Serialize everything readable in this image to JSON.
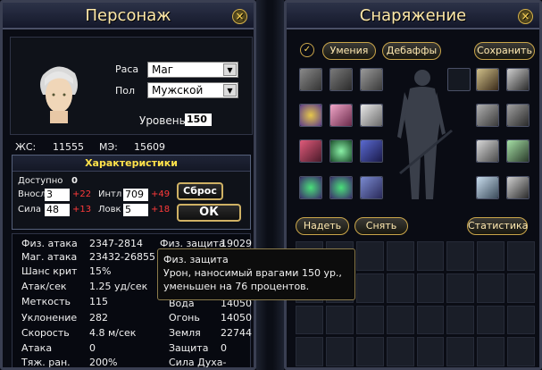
{
  "left": {
    "title": "Персонаж",
    "race_label": "Раса",
    "race_value": "Маг",
    "gender_label": "Пол",
    "gender_value": "Мужской",
    "level_label": "Уровень",
    "level_value": "150",
    "hp_label": "ЖС:",
    "hp_value": "11555",
    "mp_label": "МЭ:",
    "mp_value": "15609",
    "chars_title": "Характеристики",
    "available_label": "Доступно",
    "available_value": "0",
    "vnsl_label": "Вносл",
    "vnsl_value": "3",
    "vnsl_bonus": "+22",
    "intl_label": "Интл",
    "intl_value": "709",
    "intl_bonus": "+49",
    "sila_label": "Сила",
    "sila_value": "48",
    "sila_bonus": "+13",
    "lovk_label": "Ловк",
    "lovk_value": "5",
    "lovk_bonus": "+18",
    "reset_label": "Сброс",
    "ok_label": "ОК",
    "stats": [
      {
        "label": "Физ. атака",
        "value": "2347-2814"
      },
      {
        "label": "Маг. атака",
        "value": "23432-26855"
      },
      {
        "label": "Шанс крит",
        "value": "15%"
      },
      {
        "label": "Атак/сек",
        "value": "1.25 уд/сек"
      },
      {
        "label": "Меткость",
        "value": "115"
      },
      {
        "label": "Уклонение",
        "value": "282"
      },
      {
        "label": "Скорость",
        "value": "4.8 м/сек"
      },
      {
        "label": "Атака",
        "value": "0"
      },
      {
        "label": "Тяж. ран.",
        "value": "200%"
      }
    ],
    "defs": [
      {
        "label": "Физ. защита",
        "value": "19029"
      },
      {
        "label": "Вода",
        "value": "14050"
      },
      {
        "label": "Огонь",
        "value": "14050"
      },
      {
        "label": "Земля",
        "value": "22744"
      },
      {
        "label": "Защита",
        "value": "0"
      },
      {
        "label": "Сила Духа-",
        "value": ""
      }
    ]
  },
  "right": {
    "title": "Снаряжение",
    "skills_label": "Умения",
    "debuffs_label": "Дебаффы",
    "save_label": "Сохранить",
    "equip_label": "Надеть",
    "remove_label": "Снять",
    "stats_label": "Статистика"
  },
  "tooltip": {
    "title": "Физ. защита",
    "line1": "Урон, наносимый врагами 150 ур.,",
    "line2": "уменьшен на 76 процентов."
  },
  "close_icon": "×"
}
